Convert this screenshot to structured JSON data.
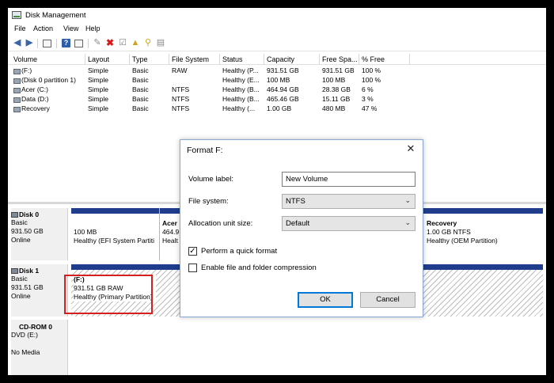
{
  "window": {
    "title": "Disk Management"
  },
  "menu": [
    "File",
    "Action",
    "View",
    "Help"
  ],
  "toolbar": {
    "icons": [
      "back-arrow-icon",
      "forward-arrow-icon",
      "console-tree-icon",
      "help-icon",
      "view-icon",
      "connect-icon",
      "delete-icon",
      "properties-icon",
      "import-icon",
      "rescan-icon",
      "refresh-icon"
    ]
  },
  "volume_table": {
    "headers": [
      "Volume",
      "Layout",
      "Type",
      "File System",
      "Status",
      "Capacity",
      "Free Spa...",
      "% Free"
    ],
    "rows": [
      [
        "(F:)",
        "Simple",
        "Basic",
        "RAW",
        "Healthy (P...",
        "931.51 GB",
        "931.51 GB",
        "100 %"
      ],
      [
        "(Disk 0 partition 1)",
        "Simple",
        "Basic",
        "",
        "Healthy (E...",
        "100 MB",
        "100 MB",
        "100 %"
      ],
      [
        "Acer (C:)",
        "Simple",
        "Basic",
        "NTFS",
        "Healthy (B...",
        "464.94 GB",
        "28.38 GB",
        "6 %"
      ],
      [
        "Data (D:)",
        "Simple",
        "Basic",
        "NTFS",
        "Healthy (B...",
        "465.46 GB",
        "15.11 GB",
        "3 %"
      ],
      [
        "Recovery",
        "Simple",
        "Basic",
        "NTFS",
        "Healthy (...",
        "1.00 GB",
        "480 MB",
        "47 %"
      ]
    ]
  },
  "disks": [
    {
      "name": "Disk 0",
      "info": [
        "Basic",
        "931.50 GB",
        "Online"
      ],
      "partitions": [
        {
          "lines": [
            "",
            "100 MB",
            "Healthy (EFI System Partiti"
          ]
        },
        {
          "lines": [
            "Acer",
            "464.9",
            "Healt"
          ]
        },
        {
          "lines": [
            "Recovery",
            "1.00 GB NTFS",
            "Healthy (OEM Partition)"
          ]
        }
      ]
    },
    {
      "name": "Disk 1",
      "info": [
        "Basic",
        "931.51 GB",
        "Online"
      ],
      "partitions": [
        {
          "lines": [
            "(F:)",
            "931.51 GB RAW",
            "Healthy (Primary Partition)"
          ]
        }
      ]
    },
    {
      "name": "CD-ROM 0",
      "info": [
        "DVD (E:)",
        "",
        "No Media"
      ]
    }
  ],
  "dialog": {
    "title": "Format F:",
    "volume_label_lbl": "Volume label:",
    "volume_label_value": "New Volume",
    "file_system_lbl": "File system:",
    "file_system_value": "NTFS",
    "alloc_lbl": "Allocation unit size:",
    "alloc_value": "Default",
    "quick_format_lbl": "Perform a quick format",
    "quick_format_checked": true,
    "compression_lbl": "Enable file and folder compression",
    "compression_checked": false,
    "ok_label": "OK",
    "cancel_label": "Cancel",
    "close_glyph": "✕"
  },
  "colors": {
    "partition_bar": "#1f3d8c",
    "highlight": "#d42020",
    "dialog_border": "#8aa8d6",
    "primary_button_border": "#0078d7"
  }
}
